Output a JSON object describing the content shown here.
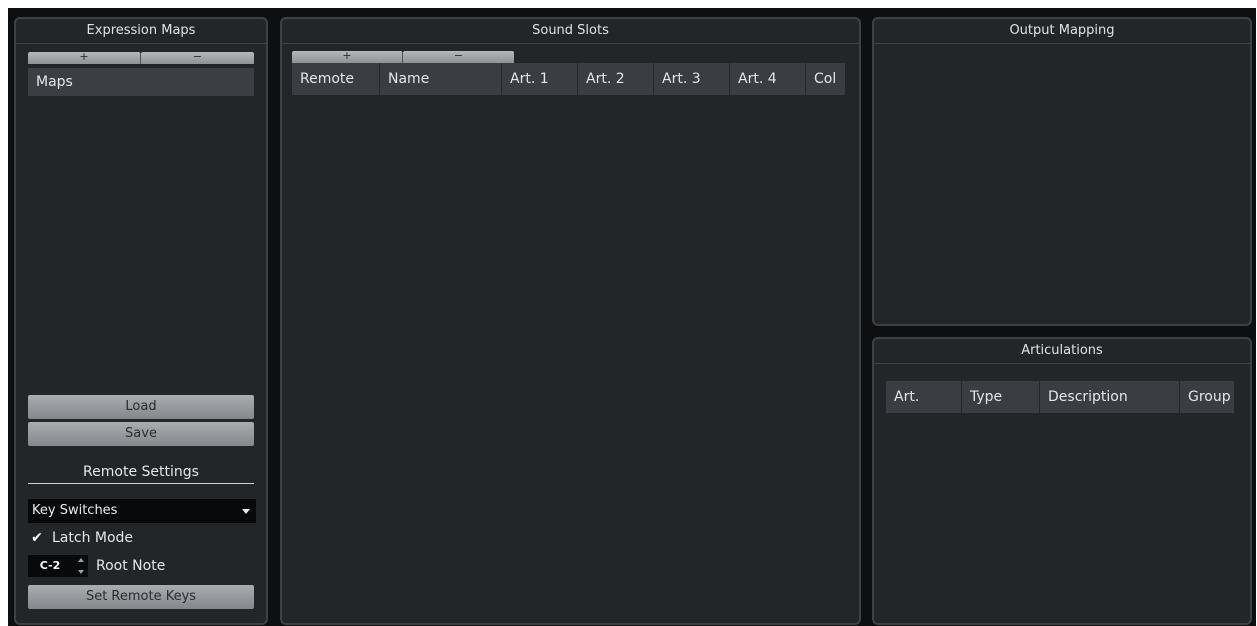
{
  "expression_maps": {
    "title": "Expression Maps",
    "add_label": "+",
    "remove_label": "−",
    "list_items": [
      {
        "label": "Maps"
      }
    ],
    "load_label": "Load",
    "save_label": "Save"
  },
  "remote_settings": {
    "title": "Remote Settings",
    "mode_select": {
      "value": "Key Switches"
    },
    "latch_mode": {
      "label": "Latch Mode",
      "checked": true
    },
    "root_note": {
      "value": "C-2",
      "label": "Root Note"
    },
    "set_remote_keys_label": "Set Remote Keys"
  },
  "sound_slots": {
    "title": "Sound Slots",
    "add_label": "+",
    "remove_label": "−",
    "columns": [
      "Remote",
      "Name",
      "Art. 1",
      "Art. 2",
      "Art. 3",
      "Art. 4",
      "Col"
    ]
  },
  "output_mapping": {
    "title": "Output Mapping"
  },
  "articulations": {
    "title": "Articulations",
    "columns": [
      "Art.",
      "Type",
      "Description",
      "Group"
    ]
  },
  "colors": {
    "panel_bg": "#232629",
    "header_bg": "#3a3e42",
    "window_bg": "#0d0f11",
    "button_gray": "#a9adb0"
  },
  "icons": {
    "check": "checkmark-icon",
    "dropdown": "chevron-down-icon",
    "stepper": "stepper-arrows-icon"
  }
}
